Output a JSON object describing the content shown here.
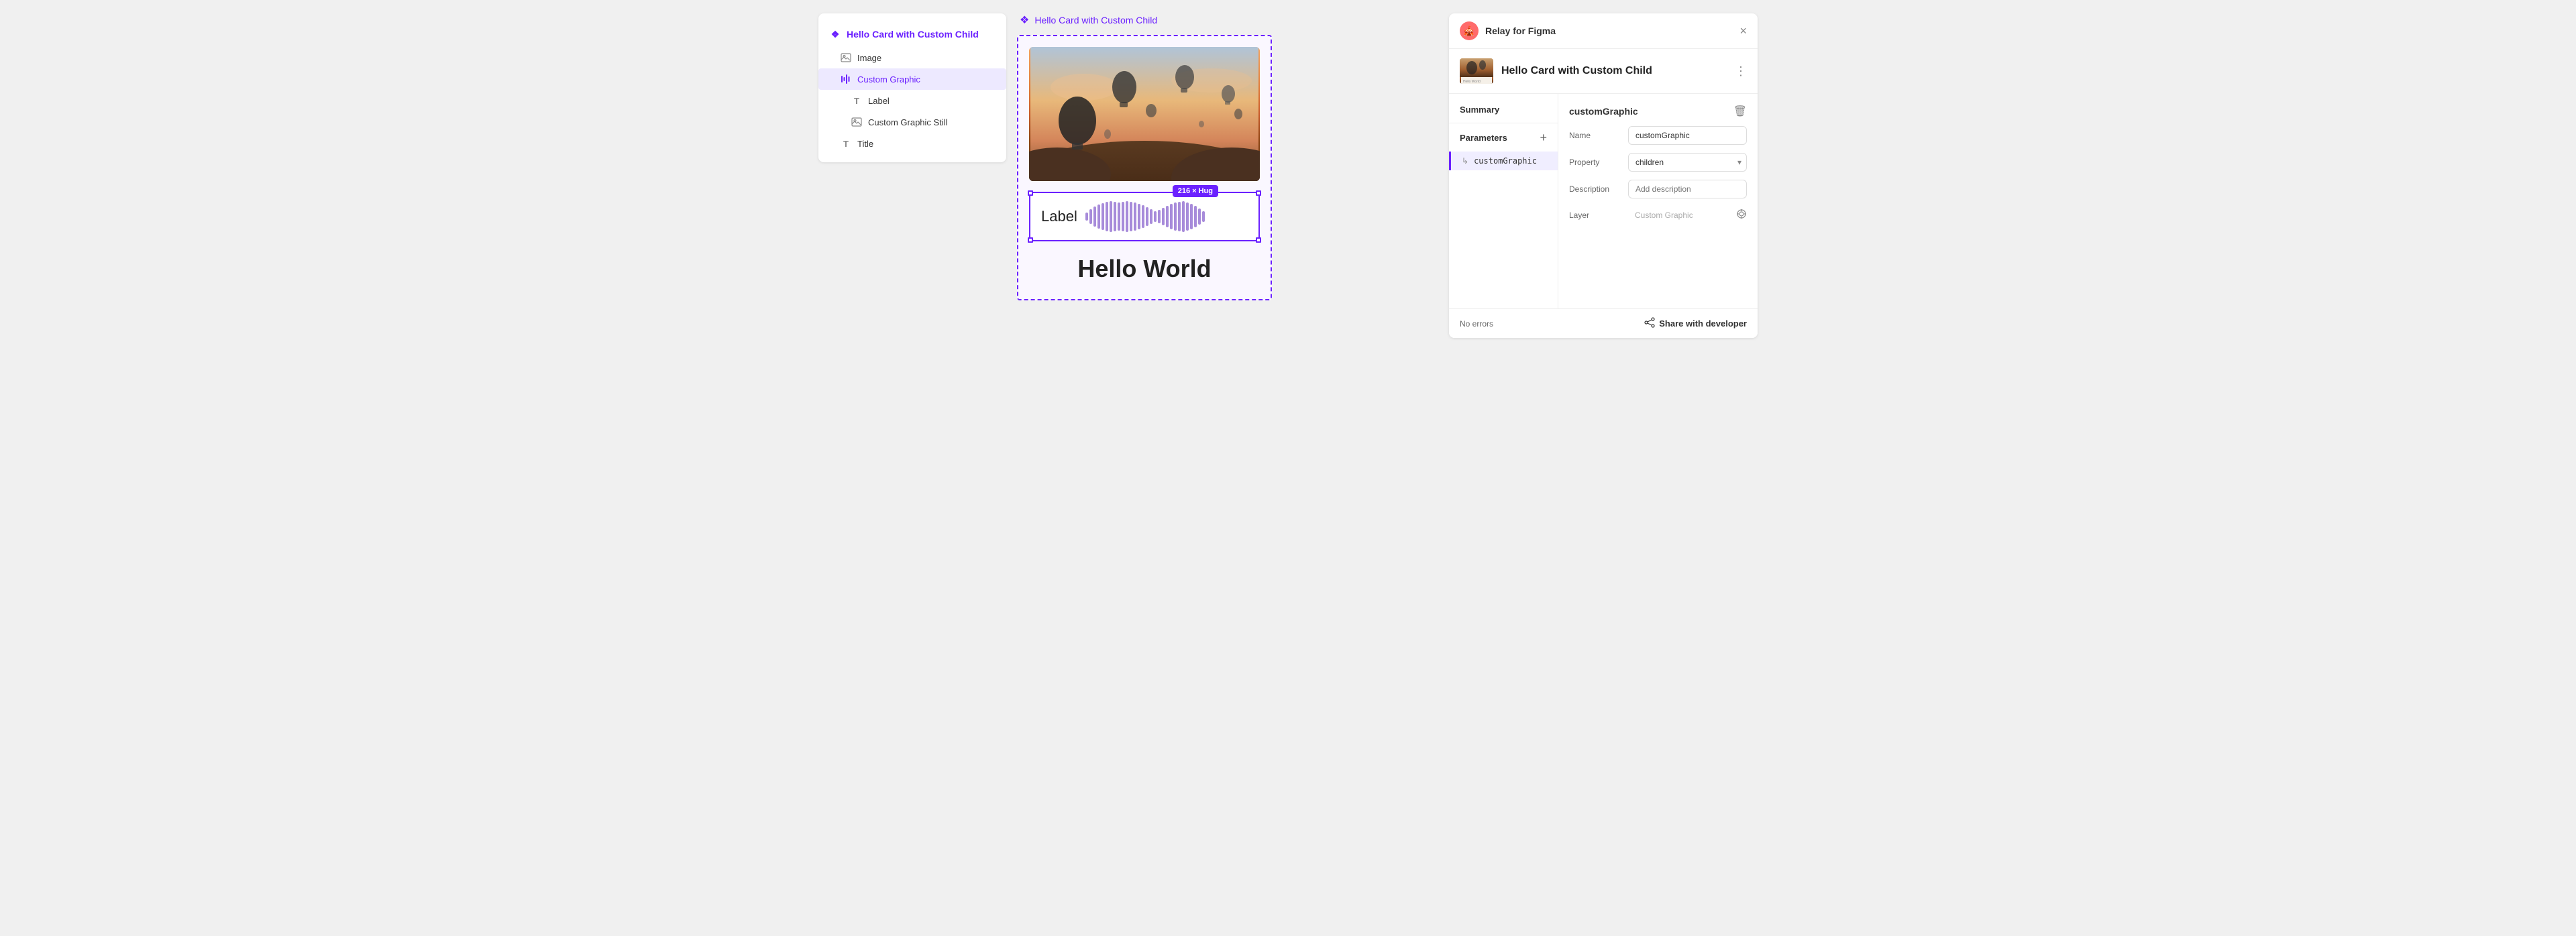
{
  "layerPanel": {
    "items": [
      {
        "id": "root",
        "label": "Hello Card with Custom Child",
        "icon": "❖",
        "indent": 0,
        "selected": false,
        "isRoot": true
      },
      {
        "id": "image",
        "label": "Image",
        "icon": "image",
        "indent": 1,
        "selected": false
      },
      {
        "id": "customGraphic",
        "label": "Custom Graphic",
        "icon": "bars",
        "indent": 1,
        "selected": true
      },
      {
        "id": "label",
        "label": "Label",
        "icon": "T",
        "indent": 2,
        "selected": false
      },
      {
        "id": "customGraphicStill",
        "label": "Custom Graphic Still",
        "icon": "image",
        "indent": 2,
        "selected": false
      },
      {
        "id": "title",
        "label": "Title",
        "icon": "T",
        "indent": 1,
        "selected": false
      }
    ]
  },
  "canvas": {
    "header": "Hello Card with Custom Child",
    "sizeBadge": "216 × Hug",
    "labelText": "Label",
    "helloWorldText": "Hello World"
  },
  "propertiesPanel": {
    "appName": "Relay for Figma",
    "closeLabel": "×",
    "componentTitle": "Hello Card with Custom Child",
    "moreLabel": "⋮",
    "summaryLabel": "Summary",
    "parametersLabel": "Parameters",
    "addParamLabel": "+",
    "params": [
      {
        "id": "customGraphic",
        "name": "customGraphic"
      }
    ],
    "detail": {
      "name": "customGraphic",
      "trashLabel": "🗑",
      "fields": {
        "nameLabel": "Name",
        "nameValue": "customGraphic",
        "propertyLabel": "Property",
        "propertyValue": "children",
        "descriptionLabel": "Description",
        "descriptionPlaceholder": "Add description",
        "layerLabel": "Layer",
        "layerValue": "Custom Graphic"
      }
    },
    "footer": {
      "noErrors": "No errors",
      "shareLabel": "Share with developer"
    }
  }
}
